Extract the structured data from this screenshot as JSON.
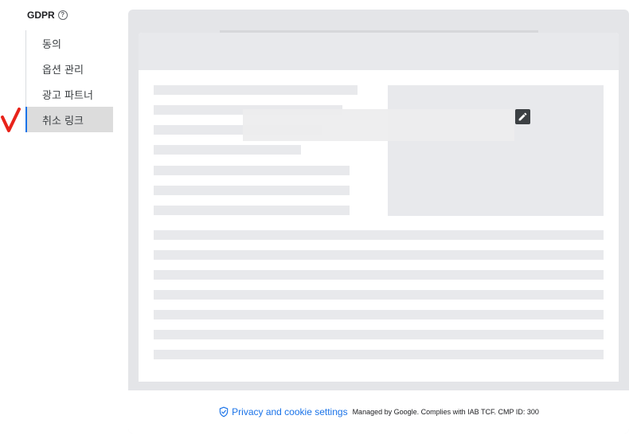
{
  "sidebar": {
    "title": "GDPR",
    "help_icon": "help-circle-icon",
    "items": [
      {
        "label": "동의",
        "active": false
      },
      {
        "label": "옵션 관리",
        "active": false
      },
      {
        "label": "광고 파트너",
        "active": false
      },
      {
        "label": "취소 링크",
        "active": true
      }
    ],
    "annotation_icon": "red-check-mark-icon"
  },
  "preview": {
    "edit_icon": "pencil-icon",
    "footer": {
      "shield_icon": "shield-check-icon",
      "link_label": "Privacy and cookie settings",
      "managed_text": "Managed by Google. Complies with IAB TCF. CMP ID: 300"
    }
  },
  "colors": {
    "accent": "#1a73e8",
    "placeholder": "#e8e9ec",
    "frame": "#e4e5e8",
    "active_item_bg": "#dcdcdc",
    "check_mark": "#e8231a"
  }
}
